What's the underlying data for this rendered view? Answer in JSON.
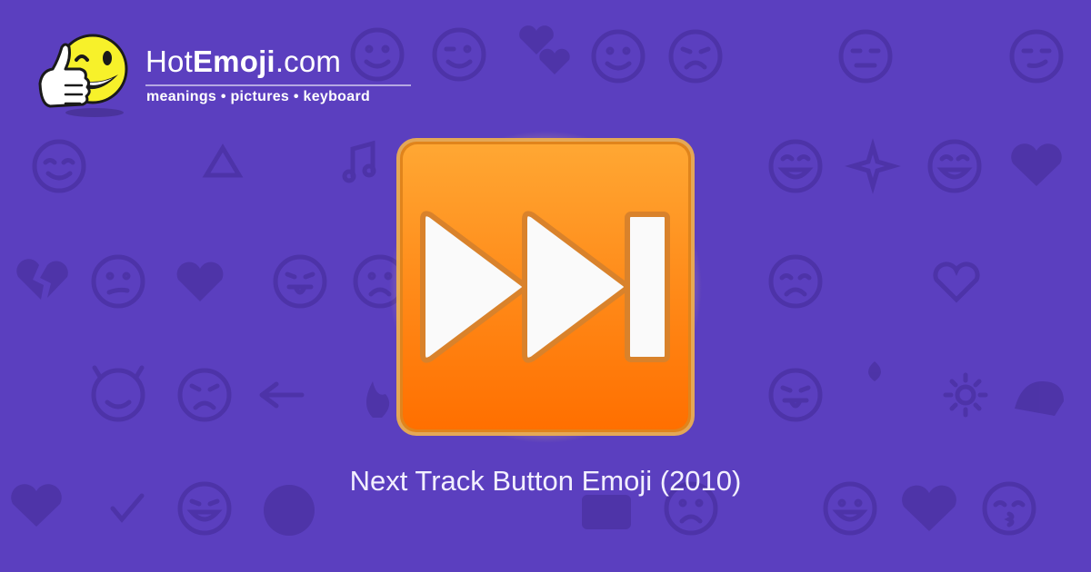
{
  "brand": {
    "name_regular": "Hot",
    "name_bold": "Emoji",
    "name_suffix": ".com",
    "tagline": "meanings • pictures • keyboard"
  },
  "emoji": {
    "icon": "next-track-button",
    "caption": "Next Track Button Emoji (2010)"
  },
  "colors": {
    "background": "#5b3fbf",
    "pattern": "#4d35a6",
    "button_top": "#ffa733",
    "button_bottom": "#ff6f00",
    "glyph": "#fafafa"
  }
}
